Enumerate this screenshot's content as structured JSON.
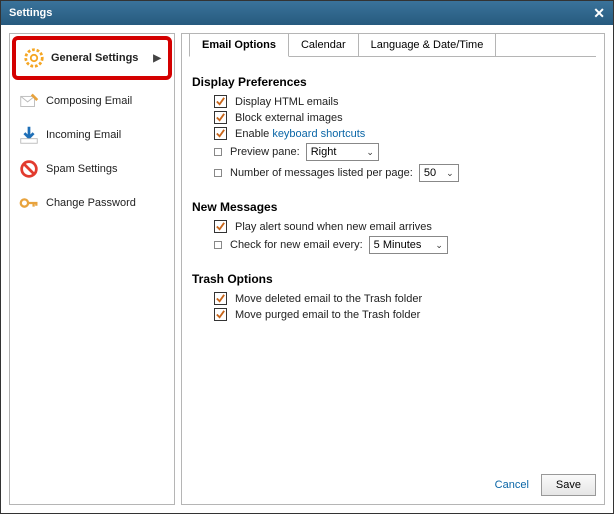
{
  "title": "Settings",
  "sidebar": {
    "items": [
      {
        "label": "General Settings"
      },
      {
        "label": "Composing Email"
      },
      {
        "label": "Incoming Email"
      },
      {
        "label": "Spam Settings"
      },
      {
        "label": "Change Password"
      }
    ]
  },
  "tabs": {
    "items": [
      {
        "label": "Email Options"
      },
      {
        "label": "Calendar"
      },
      {
        "label": "Language & Date/Time"
      }
    ]
  },
  "sections": {
    "display_prefs": {
      "title": "Display Preferences",
      "opts": {
        "html_emails": "Display HTML emails",
        "block_ext": "Block external images",
        "enable_pre": "Enable ",
        "enable_link": "keyboard shortcuts",
        "preview_pane": "Preview pane:",
        "preview_val": "Right",
        "per_page_label": "Number of messages listed per page:",
        "per_page_val": "50"
      }
    },
    "new_msgs": {
      "title": "New Messages",
      "opts": {
        "play_sound": "Play alert sound when new email arrives",
        "check_label": "Check for new email every:",
        "check_val": "5 Minutes"
      }
    },
    "trash": {
      "title": "Trash Options",
      "opts": {
        "move_deleted": "Move deleted email to the Trash folder",
        "move_purged": "Move purged email to the Trash folder"
      }
    }
  },
  "footer": {
    "cancel": "Cancel",
    "save": "Save"
  }
}
